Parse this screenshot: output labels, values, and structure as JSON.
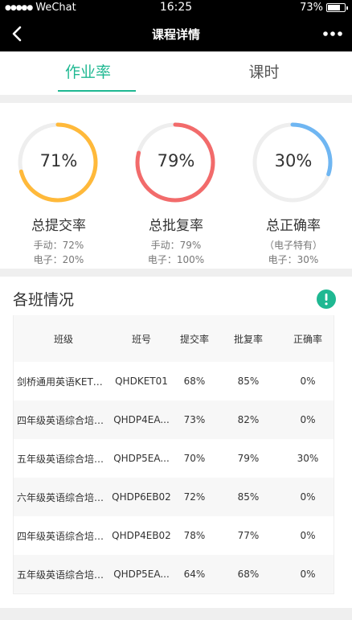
{
  "status_bar": {
    "carrier": "WeChat",
    "time": "16:25",
    "battery": "73%",
    "battery_level": 0.73
  },
  "nav": {
    "title": "课程详情"
  },
  "tabs": [
    {
      "label": "作业率",
      "active": true
    },
    {
      "label": "课时",
      "active": false
    }
  ],
  "stats": [
    {
      "value": "71%",
      "fraction": 0.71,
      "color": "#ffb93a",
      "label": "总提交率",
      "sub1": "手动：72%",
      "sub2": "电子：20%"
    },
    {
      "value": "79%",
      "fraction": 0.79,
      "color": "#f26b6b",
      "label": "总批复率",
      "sub1": "手动：79%",
      "sub2": "电子：100%"
    },
    {
      "value": "30%",
      "fraction": 0.3,
      "color": "#6fb6f2",
      "label": "总正确率",
      "sub1": "（电子特有）",
      "sub2": "电子：30%"
    }
  ],
  "classes": {
    "title": "各班情况",
    "headers": [
      "班级",
      "班号",
      "提交率",
      "批复率",
      "正确率"
    ],
    "rows": [
      [
        "剑桥通用英语KET冲...",
        "QHDKET01",
        "68%",
        "85%",
        "0%"
      ],
      [
        "四年级英语综合培优...",
        "QHDP4EA...",
        "73%",
        "82%",
        "0%"
      ],
      [
        "五年级英语综合培优...",
        "QHDP5EA...",
        "70%",
        "79%",
        "30%"
      ],
      [
        "六年级英语综合培优...",
        "QHDP6EB02",
        "72%",
        "85%",
        "0%"
      ],
      [
        "四年级英语综合培优...",
        "QHDP4EB02",
        "78%",
        "77%",
        "0%"
      ],
      [
        "五年级英语综合培优...",
        "QHDP5EA...",
        "64%",
        "68%",
        "0%"
      ]
    ]
  }
}
